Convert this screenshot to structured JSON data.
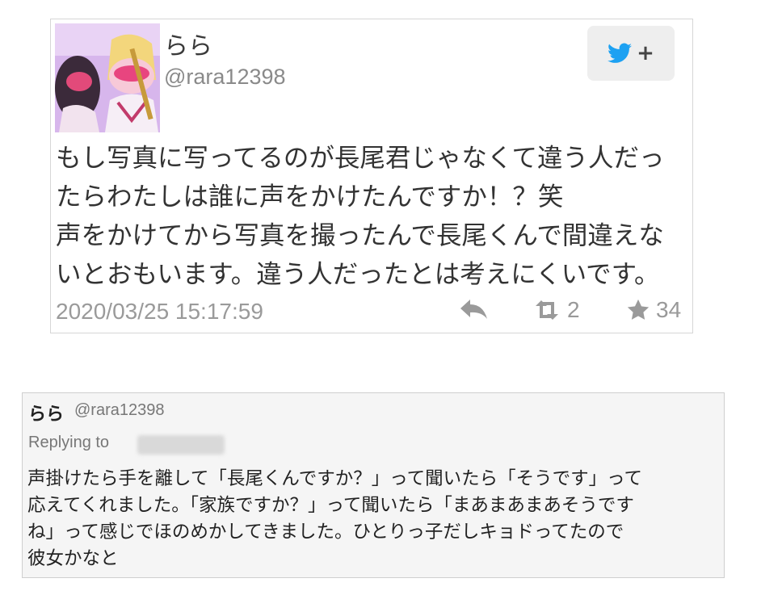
{
  "tweet": {
    "display_name": "らら",
    "handle": "@rara12398",
    "follow_icon": "twitter-bird-icon",
    "follow_plus": "+",
    "lines": [
      "もし写真に写ってるのが長尾君じゃなくて違う人だっ",
      "たらわたしは誰に声をかけたんですか！？笑",
      "声をかけてから写真を撮ったんで長尾くんで間違えな",
      "いとおもいます。違う人だったとは考えにくいです。"
    ],
    "timestamp": "2020/03/25 15:17:59",
    "retweet_count": "2",
    "like_count": "34",
    "colors": {
      "bird": "#1da1f2",
      "icon_grey": "#9a9a9a"
    }
  },
  "reply": {
    "display_name": "らら",
    "handle": "@rara12398",
    "replying_label": "Replying to",
    "lines": [
      "声掛けたら手を離して「長尾くんですか？」って聞いたら「そうです」って",
      "応えてくれました。「家族ですか？」って聞いたら「まあまあまあそうです",
      "ね」って感じでほのめかしてきました。ひとりっ子だしキョドってたので",
      "彼女かなと"
    ]
  }
}
